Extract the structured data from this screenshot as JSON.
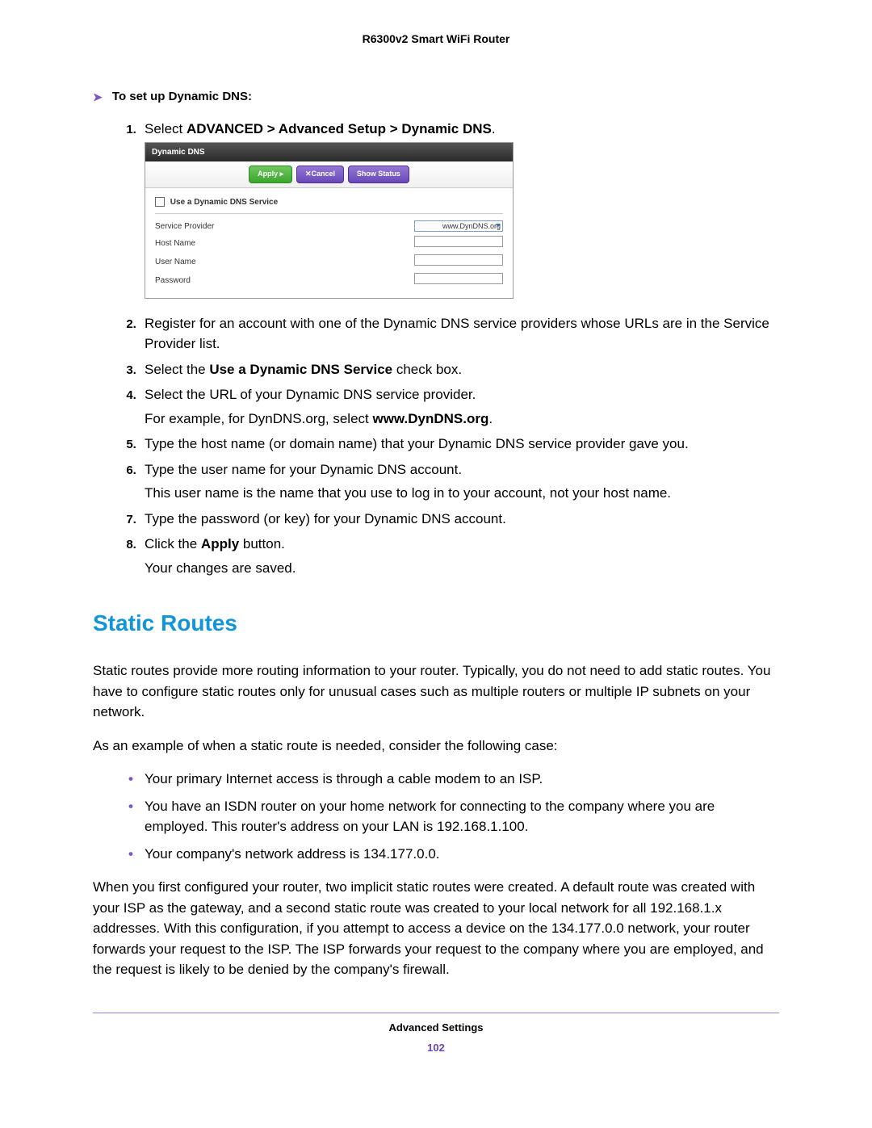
{
  "doc_title": "R6300v2 Smart WiFi Router",
  "section_lead": "To set up Dynamic DNS:",
  "steps": {
    "s1": {
      "prefix": "Select ",
      "bold": "ADVANCED > Advanced Setup > Dynamic DNS",
      "suffix": "."
    },
    "s2": "Register for an account with one of the Dynamic DNS service providers whose URLs are in the Service Provider list.",
    "s3": {
      "prefix": "Select the ",
      "bold": "Use a Dynamic DNS Service",
      "suffix": " check box."
    },
    "s4": {
      "line1": "Select the URL of your Dynamic DNS service provider.",
      "line2_prefix": "For example, for DynDNS.org, select ",
      "line2_bold": "www.DynDNS.org",
      "line2_suffix": "."
    },
    "s5": "Type the host name (or domain name) that your Dynamic DNS service provider gave you.",
    "s6": {
      "line1": "Type the user name for your Dynamic DNS account.",
      "line2": "This user name is the name that you use to log in to your account, not your host name."
    },
    "s7": "Type the password (or key) for your Dynamic DNS account.",
    "s8": {
      "line1_prefix": "Click the ",
      "line1_bold": "Apply",
      "line1_suffix": " button.",
      "line2": "Your changes are saved."
    }
  },
  "screenshot": {
    "title": "Dynamic DNS",
    "btn_apply": "Apply ▸",
    "btn_cancel": "✕Cancel",
    "btn_show": "Show Status",
    "checkbox_label": "Use a Dynamic DNS Service",
    "rows": {
      "provider_label": "Service Provider",
      "provider_value": "www.DynDNS.org",
      "host_label": "Host Name",
      "user_label": "User Name",
      "pass_label": "Password"
    }
  },
  "heading": "Static Routes",
  "para1": "Static routes provide more routing information to your router. Typically, you do not need to add static routes. You have to configure static routes only for unusual cases such as multiple routers or multiple IP subnets on your network.",
  "para2": "As an example of when a static route is needed, consider the following case:",
  "bullets": {
    "b1": "Your primary Internet access is through a cable modem to an ISP.",
    "b2": "You have an ISDN router on your home network for connecting to the company where you are employed. This router's address on your LAN is 192.168.1.100.",
    "b3": "Your company's network address is 134.177.0.0."
  },
  "para3": "When you first configured your router, two implicit static routes were created. A default route was created with your ISP as the gateway, and a second static route was created to your local network for all 192.168.1.x addresses. With this configuration, if you attempt to access a device on the 134.177.0.0 network, your router forwards your request to the ISP. The ISP forwards your request to the company where you are employed, and the request is likely to be denied by the company's firewall.",
  "footer": "Advanced Settings",
  "page_number": "102"
}
